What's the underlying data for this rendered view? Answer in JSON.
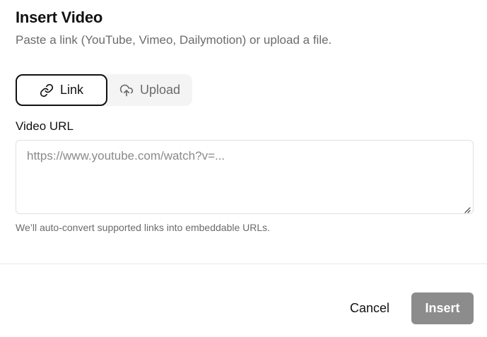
{
  "dialog": {
    "title": "Insert Video",
    "subtitle": "Paste a link (YouTube, Vimeo, Dailymotion) or upload a file."
  },
  "source_tabs": {
    "selected": "link",
    "items": [
      {
        "id": "link",
        "label": "Link",
        "icon": "link-icon"
      },
      {
        "id": "upload",
        "label": "Upload",
        "icon": "cloud-upload-icon"
      }
    ]
  },
  "url_field": {
    "label": "Video URL",
    "value": "",
    "placeholder": "https://www.youtube.com/watch?v=...",
    "helper": "We’ll auto-convert supported links into embeddable URLs."
  },
  "actions": {
    "cancel_label": "Cancel",
    "insert_label": "Insert",
    "insert_enabled": false
  },
  "colors": {
    "text": "#111111",
    "muted": "#6b6b6b",
    "segment_bg": "#f4f4f5",
    "insert_disabled_bg": "#8c8c8c",
    "border": "#e0e0e0"
  }
}
